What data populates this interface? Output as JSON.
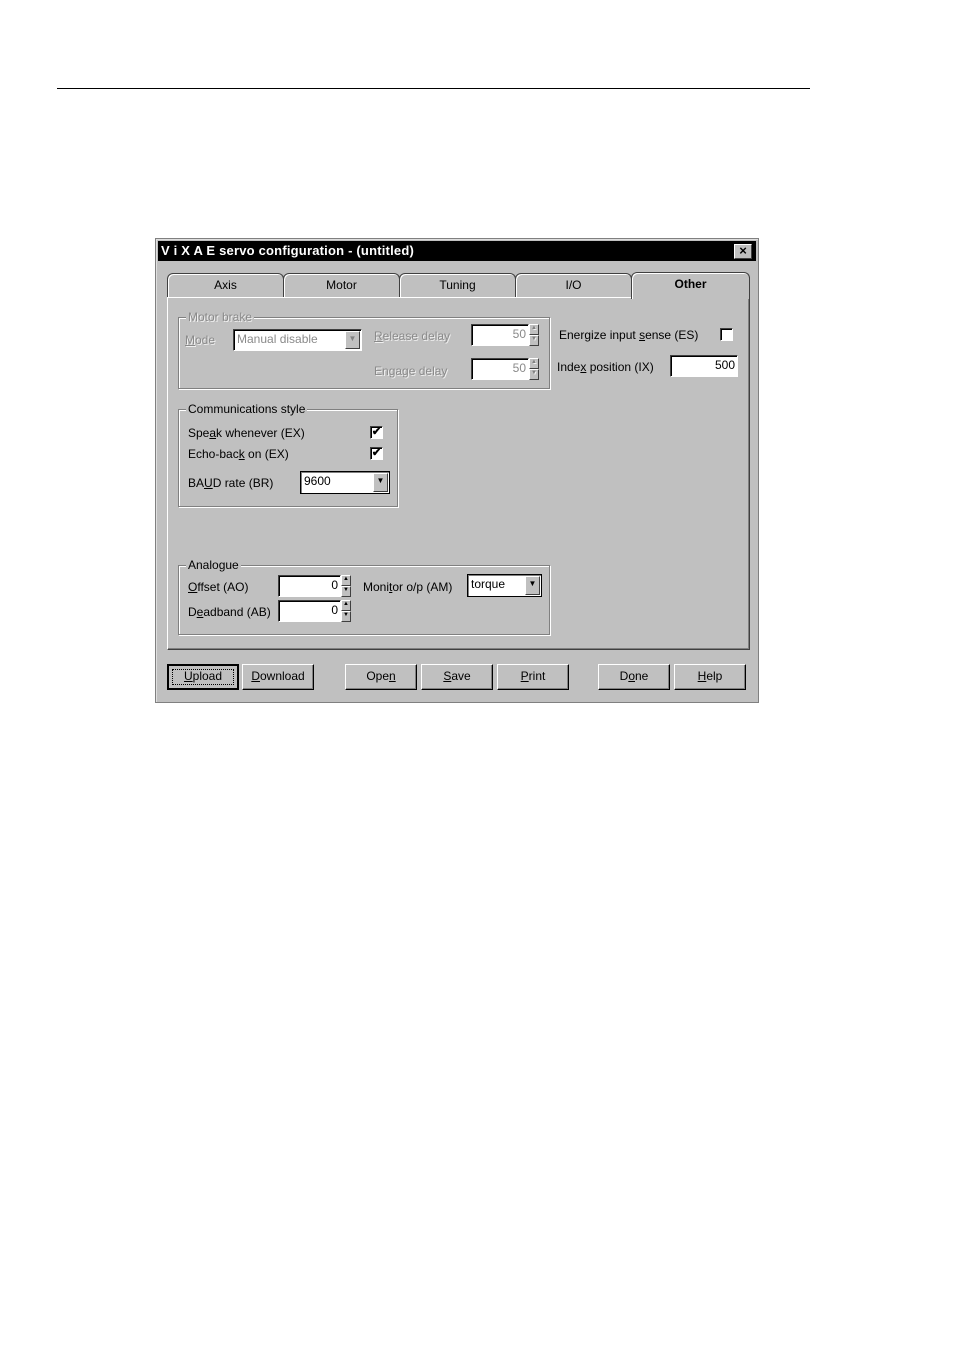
{
  "window": {
    "title": "V i X A E servo configuration - (untitled)",
    "close_icon": "×"
  },
  "tabs": [
    {
      "label": "Axis",
      "active": false
    },
    {
      "label": "Motor",
      "active": false
    },
    {
      "label": "Tuning",
      "active": false
    },
    {
      "label": "I/O",
      "active": false
    },
    {
      "label": "Other",
      "active": true
    }
  ],
  "motor_brake": {
    "group_label": "Motor brake",
    "mode_label_u": "M",
    "mode_label_rest": "ode",
    "mode_value": "Manual disable",
    "release_delay_label_u": "R",
    "release_delay_label_rest": "elease delay",
    "release_delay_value": "50",
    "engage_delay_label_pre": "En",
    "engage_delay_label_u": "g",
    "engage_delay_label_rest": "age delay",
    "engage_delay_value": "50",
    "enabled": false
  },
  "energize": {
    "label_pre": "Energize input ",
    "label_u": "s",
    "label_rest": "ense (ES)",
    "checked": false,
    "check_glyph": ""
  },
  "index_position": {
    "label_pre": "Inde",
    "label_u": "x",
    "label_rest": " position (IX)",
    "value": "500"
  },
  "communications": {
    "group_label": "Communications style",
    "speak_label_pre": "Spe",
    "speak_label_u": "a",
    "speak_label_rest": "k whenever (EX)",
    "speak_checked": true,
    "speak_glyph": "✔",
    "echo_label_pre": "Echo-bac",
    "echo_label_u": "k",
    "echo_label_rest": " on (EX)",
    "echo_checked": true,
    "echo_glyph": "✔",
    "baud_label_pre": "BA",
    "baud_label_u": "U",
    "baud_label_rest": "D rate (BR)",
    "baud_value": "9600"
  },
  "analogue": {
    "group_label": "Analogue",
    "offset_label_u": "O",
    "offset_label_rest": "ffset (AO)",
    "offset_value": "0",
    "deadband_label_pre": "D",
    "deadband_label_u": "e",
    "deadband_label_rest": "adband (AB)",
    "deadband_value": "0",
    "monitor_label_pre": "Moni",
    "monitor_label_u": "t",
    "monitor_label_rest": "or o/p (AM)",
    "monitor_value": "torque"
  },
  "icons": {
    "spin_up": "▲",
    "spin_down": "▼",
    "dropdown": "▼"
  },
  "buttons": {
    "upload_u": "U",
    "upload_rest": "pload",
    "download_u": "D",
    "download_rest": "ownload",
    "open_pre": "Ope",
    "open_u": "n",
    "save_u": "S",
    "save_rest": "ave",
    "print_u": "P",
    "print_rest": "rint",
    "done_pre": "D",
    "done_u": "o",
    "done_rest": "ne",
    "help_u": "H",
    "help_rest": "elp"
  }
}
